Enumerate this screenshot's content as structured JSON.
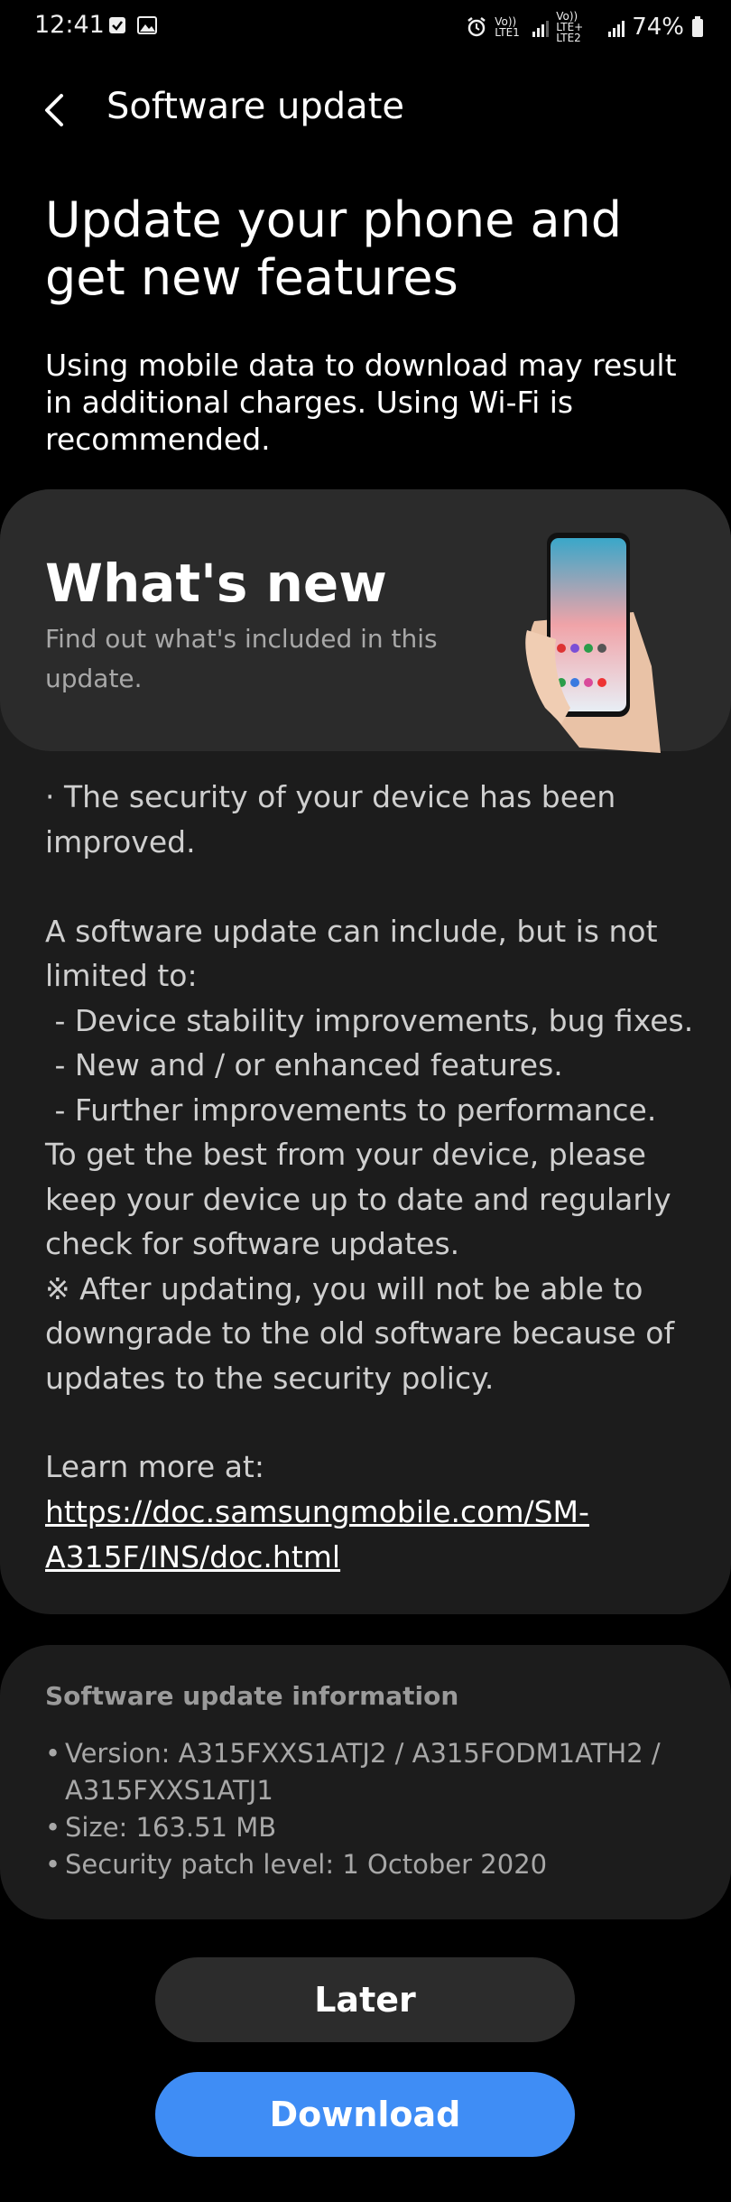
{
  "status_bar": {
    "time": "12:41",
    "sim1_label": "Vo)) LTE1",
    "sim2_label": "Vo)) LTE+ LTE2",
    "battery": "74%"
  },
  "header": {
    "title": "Software update",
    "back_icon": "back-arrow-icon"
  },
  "headline": "Update your phone and get new features",
  "warning": "Using mobile data to download may result in additional charges. Using Wi-Fi is recommended.",
  "whats_new": {
    "title": "What's new",
    "subtitle": "Find out what's included in this update.",
    "notes": "· The security of your device has been improved.\n\nA software update can include, but is not limited to:\n - Device stability improvements, bug fixes.\n - New and / or enhanced features.\n - Further improvements to performance.\nTo get the best from your device, please keep your device up to date and regularly check for software updates.\n※ After updating, you will not be able to downgrade to the old software because of updates to the security policy.",
    "learn_more_label": "Learn more at:",
    "link": "https://doc.samsungmobile.com/SM-A315F/INS/doc.html"
  },
  "update_info": {
    "title": "Software update information",
    "version": "Version: A315FXXS1ATJ2 / A315FODM1ATH2 / A315FXXS1ATJ1",
    "size": "Size: 163.51 MB",
    "patch": "Security patch level: 1 October 2020"
  },
  "buttons": {
    "later": "Later",
    "download": "Download"
  },
  "colors": {
    "accent": "#3f8df5",
    "card": "#1c1c1c",
    "card_header": "#2b2b2b"
  }
}
